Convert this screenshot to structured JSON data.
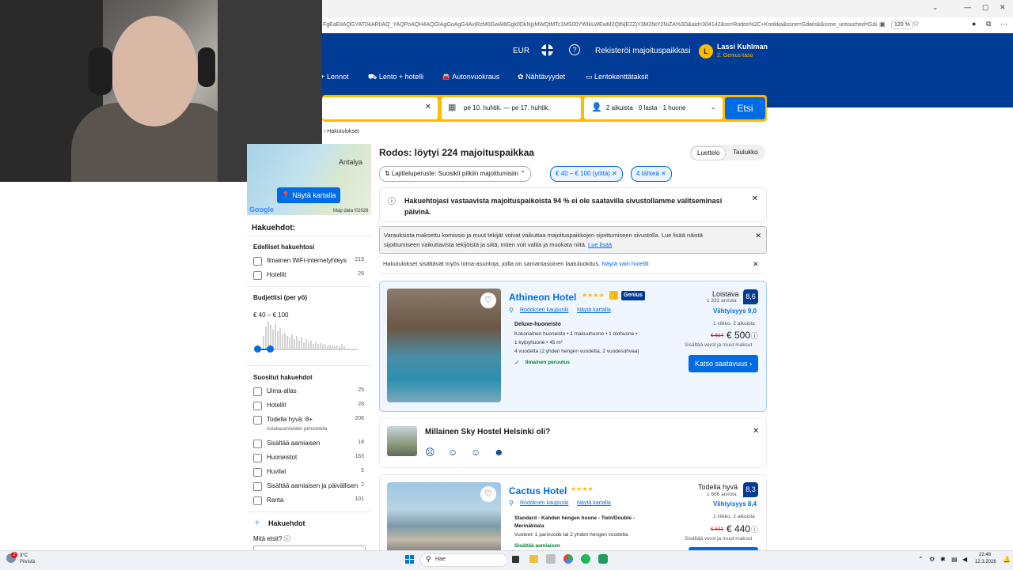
{
  "browser": {
    "url": "FgEaEiIAQGYAT04ARIIAQ_YAQPoAQH4AQGIAgGoAgG4AvjRzM0GwAl8Ggk0DkNjyMWQtMTc1MS00YWIkLWEwM2QtNjE2ZjY3M2NiY2NiZA%3D&aid=304142&ss=Rodos%2C+Kreikka&ssne=Gdańsk&ssne_untouched=Gdańsk",
    "zoom": "120 %"
  },
  "header": {
    "currency": "EUR",
    "register": "Rekisteröi majoituspaikkasi",
    "user_name": "Lassi Kuhlman",
    "user_level": "2. Genius-taso",
    "avatar_letter": "L",
    "nav": [
      "Lennot",
      "Lento + hotelli",
      "Autonvuokraus",
      "Nähtävyydet",
      "Lentokenttätaksit"
    ]
  },
  "search": {
    "dates": "pe 10. huhtik. — pe 17. huhtik.",
    "guests": "2 aikuista · 0 lasta · 1 huone",
    "button": "Etsi"
  },
  "breadcrumb": "Hakutulokset",
  "sidebar": {
    "map_label": "Antalya",
    "map_button": "Näytä kartalla",
    "map_google": "Google",
    "map_data": "Map data ©2026",
    "filters_title": "Hakuehdot:",
    "previous_title": "Edelliset hakuehtosi",
    "previous": [
      {
        "label": "Ilmainen WiFi-internetyhteys",
        "count": "219"
      },
      {
        "label": "Hotellit",
        "count": "28"
      }
    ],
    "budget_title": "Budjettisi (per yö)",
    "budget_value": "€ 40 – € 100",
    "popular_title": "Suositut hakuehdot",
    "popular": [
      {
        "label": "Uima-allas",
        "count": "25"
      },
      {
        "label": "Hotellit",
        "count": "28"
      },
      {
        "label": "Todella hyvä: 8+",
        "count": "206",
        "sub": "Asiakasarvioiden perusteella"
      },
      {
        "label": "Sisältää aamiaisen",
        "count": "18"
      },
      {
        "label": "Huoneistot",
        "count": "163"
      },
      {
        "label": "Huvilat",
        "count": "5"
      },
      {
        "label": "Sisältää aamiaisen ja päivällisen",
        "count": "2"
      },
      {
        "label": "Ranta",
        "count": "101"
      }
    ],
    "search_filters_title": "Hakuehdot",
    "what_search": "Mitä etsit?"
  },
  "results": {
    "title": "Rodos: löytyi 224 majoituspaikkaa",
    "view_list": "Luettelo",
    "view_grid": "Taulukko",
    "sort": "Lajitteluperuste: Suosikit pitkiin majoittumisiin",
    "chip_price": "€ 40 – € 100 (yöltä)",
    "chip_stars": "4 tähteä",
    "notice_availability": "Hakuehtojasi vastaavista majoituspaikoista 94 % ei ole saatavilla sivustollamme valitseminasi päivinä.",
    "notice_commission": "Varauksista maksettu komissio ja muut tekijät voivat vaikuttaa majoituspaikkojen sijoittumiseen sivustolla. Lue lisää näistä sijoittumiseen vaikuttavista tekijöistä ja siitä, miten voit valita ja muokata niitä.",
    "notice_commission_link": "Lue lisää",
    "notice_holiday": "Hakutulokset sisältävät myös loma-asuntoja, joilla on samantasoinen laatuluokitus.",
    "notice_holiday_link": "Näytä vain hotellit",
    "survey": "Millainen Sky Hostel Helsinki oli?"
  },
  "hotels": [
    {
      "name": "Athineon Hotel",
      "stars": "★★★★",
      "genius": "Genius",
      "area": "Rodoksen kaupunki",
      "map": "Näytä kartalla",
      "rating_word": "Loistava",
      "reviews": "1 332 arviota",
      "score": "8,6",
      "comfort": "Viihtyisyys 9,0",
      "room": "Deluxe-huoneisto",
      "details1": "Kokonainen huoneisto • 1 makuuhuone • 1 olohuone •",
      "details2": "1 kylpyhuone • 45 m²",
      "beds": "4 vuodetta (2 yhden hengen vuodetta, 2 vuodesohvaa)",
      "perk": "Ilmainen peruutus",
      "duration": "1 viikko, 2 aikuista",
      "old_price": "€ 614",
      "price": "€ 500",
      "taxes": "Sisältää verot ja muut maksut",
      "button": "Katso saatavuus"
    },
    {
      "name": "Cactus Hotel",
      "stars": "★★★★",
      "area": "Rodoksen kaupunki",
      "map": "Näytä kartalla",
      "rating_word": "Todella hyvä",
      "reviews": "1 686 arviota",
      "score": "8,3",
      "comfort": "Viihtyisyys 8,4",
      "room": "Standard - Kahden hengen huone - Twin/Double - Merinäköala",
      "beds": "Vuoteet: 1 parivuode tai 2 yhden hengen vuodetta",
      "perk": "Sisältää aamiaisen",
      "duration": "1 viikko, 2 aikuista",
      "old_price": "€ 532",
      "price": "€ 440",
      "taxes": "Sisältää verot ja muut maksut"
    }
  ],
  "taskbar": {
    "weather_temp": "3°C",
    "weather_text": "Pilvistä",
    "search": "Hae",
    "time": "22.48",
    "date": "12.3.2026"
  }
}
